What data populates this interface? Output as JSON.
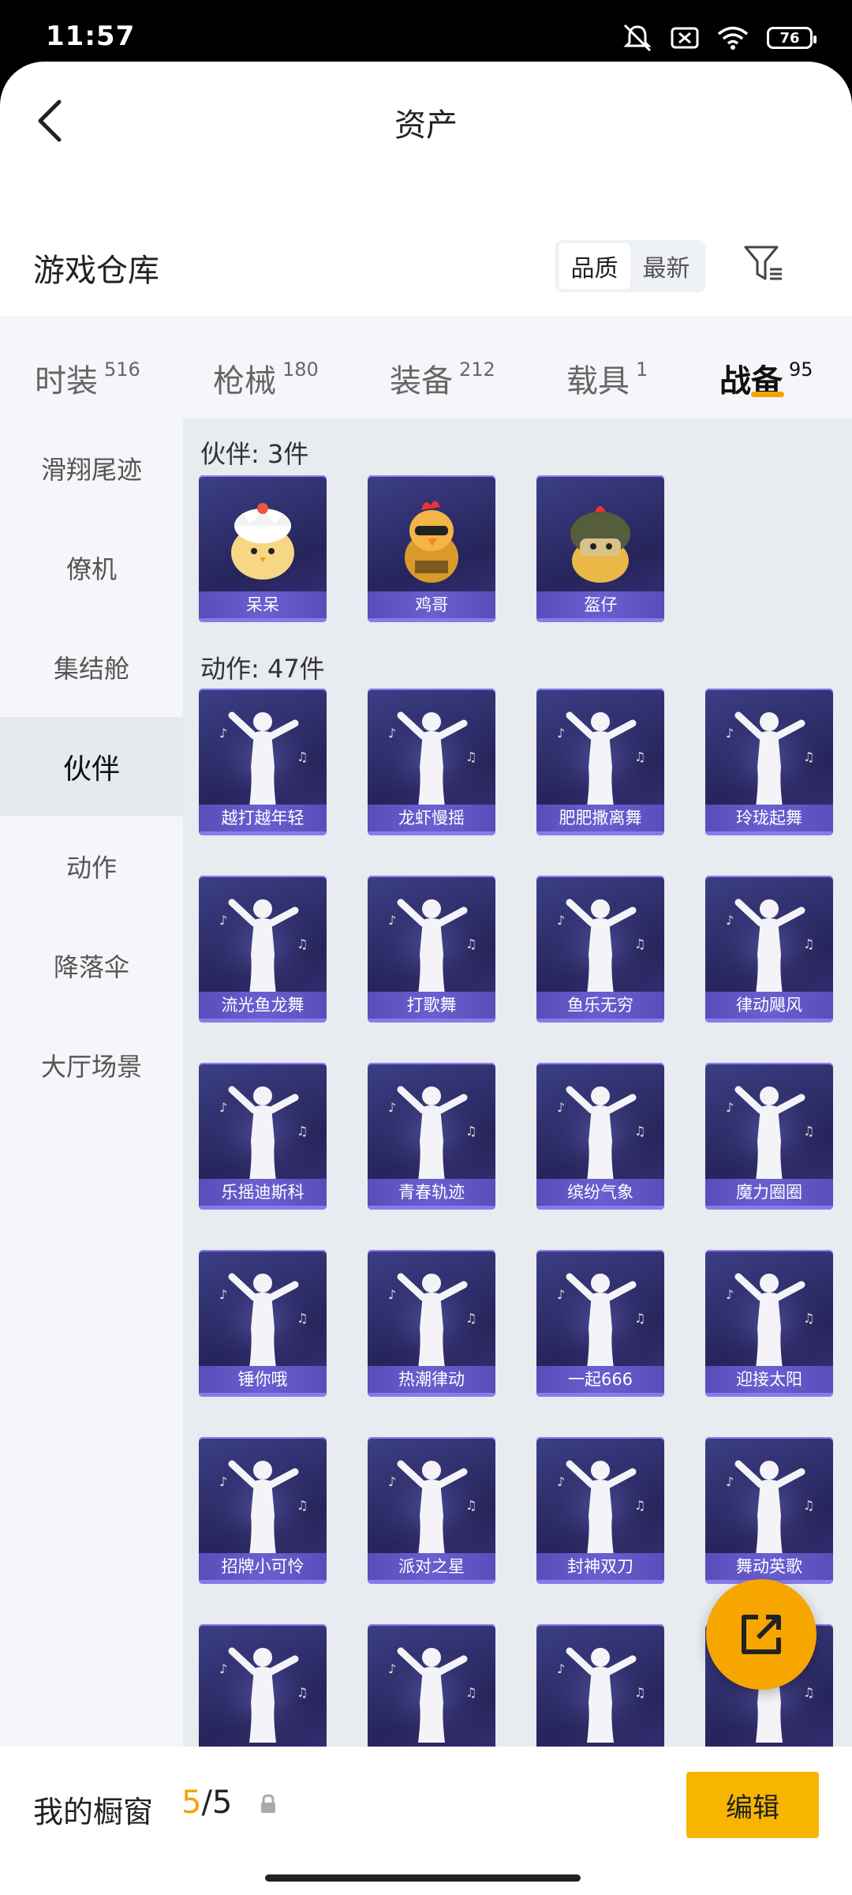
{
  "status": {
    "time": "11:57",
    "battery": "76"
  },
  "header": {
    "title": "资产"
  },
  "warehouse": {
    "title": "游戏仓库",
    "sort_options": [
      "品质",
      "最新"
    ],
    "sort_selected": "品质"
  },
  "categories": [
    {
      "name": "时装",
      "count": "516",
      "active": false
    },
    {
      "name": "枪械",
      "count": "180",
      "active": false
    },
    {
      "name": "装备",
      "count": "212",
      "active": false
    },
    {
      "name": "载具",
      "count": "1",
      "active": false
    },
    {
      "name": "战备",
      "count": "95",
      "active": true
    }
  ],
  "sidebar": {
    "items": [
      "滑翔尾迹",
      "僚机",
      "集结舱",
      "伙伴",
      "动作",
      "降落伞",
      "大厅场景"
    ],
    "selected": "伙伴"
  },
  "sections": {
    "partners": {
      "title": "伙伴: 3件",
      "items": [
        "呆呆",
        "鸡哥",
        "盔仔"
      ]
    },
    "actions": {
      "title": "动作: 47件",
      "items": [
        "越打越年轻",
        "龙虾慢摇",
        "肥肥撒离舞",
        "玲珑起舞",
        "流光鱼龙舞",
        "打歌舞",
        "鱼乐无穷",
        "律动飓风",
        "乐摇迪斯科",
        "青春轨迹",
        "缤纷气象",
        "魔力圈圈",
        "锤你哦",
        "热潮律动",
        "一起666",
        "迎接太阳",
        "招牌小可怜",
        "派对之星",
        "封神双刀",
        "舞动英歌",
        "",
        "",
        "",
        ""
      ]
    }
  },
  "bottom": {
    "window_label": "我的橱窗",
    "window_current": "5",
    "window_total": "/5",
    "edit_label": "编辑"
  },
  "colors": {
    "accent": "#f5a300",
    "card_dark": "#26245b",
    "card_label": "#5a4dba"
  }
}
